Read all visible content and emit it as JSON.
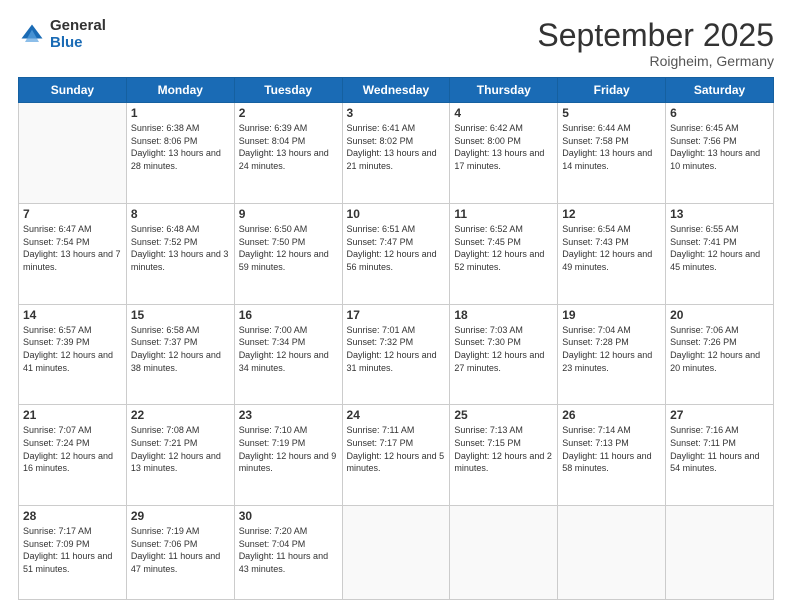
{
  "header": {
    "logo_general": "General",
    "logo_blue": "Blue",
    "title": "September 2025",
    "location": "Roigheim, Germany"
  },
  "days_of_week": [
    "Sunday",
    "Monday",
    "Tuesday",
    "Wednesday",
    "Thursday",
    "Friday",
    "Saturday"
  ],
  "weeks": [
    [
      {
        "day": "",
        "info": ""
      },
      {
        "day": "1",
        "info": "Sunrise: 6:38 AM\nSunset: 8:06 PM\nDaylight: 13 hours and 28 minutes."
      },
      {
        "day": "2",
        "info": "Sunrise: 6:39 AM\nSunset: 8:04 PM\nDaylight: 13 hours and 24 minutes."
      },
      {
        "day": "3",
        "info": "Sunrise: 6:41 AM\nSunset: 8:02 PM\nDaylight: 13 hours and 21 minutes."
      },
      {
        "day": "4",
        "info": "Sunrise: 6:42 AM\nSunset: 8:00 PM\nDaylight: 13 hours and 17 minutes."
      },
      {
        "day": "5",
        "info": "Sunrise: 6:44 AM\nSunset: 7:58 PM\nDaylight: 13 hours and 14 minutes."
      },
      {
        "day": "6",
        "info": "Sunrise: 6:45 AM\nSunset: 7:56 PM\nDaylight: 13 hours and 10 minutes."
      }
    ],
    [
      {
        "day": "7",
        "info": "Sunrise: 6:47 AM\nSunset: 7:54 PM\nDaylight: 13 hours and 7 minutes."
      },
      {
        "day": "8",
        "info": "Sunrise: 6:48 AM\nSunset: 7:52 PM\nDaylight: 13 hours and 3 minutes."
      },
      {
        "day": "9",
        "info": "Sunrise: 6:50 AM\nSunset: 7:50 PM\nDaylight: 12 hours and 59 minutes."
      },
      {
        "day": "10",
        "info": "Sunrise: 6:51 AM\nSunset: 7:47 PM\nDaylight: 12 hours and 56 minutes."
      },
      {
        "day": "11",
        "info": "Sunrise: 6:52 AM\nSunset: 7:45 PM\nDaylight: 12 hours and 52 minutes."
      },
      {
        "day": "12",
        "info": "Sunrise: 6:54 AM\nSunset: 7:43 PM\nDaylight: 12 hours and 49 minutes."
      },
      {
        "day": "13",
        "info": "Sunrise: 6:55 AM\nSunset: 7:41 PM\nDaylight: 12 hours and 45 minutes."
      }
    ],
    [
      {
        "day": "14",
        "info": "Sunrise: 6:57 AM\nSunset: 7:39 PM\nDaylight: 12 hours and 41 minutes."
      },
      {
        "day": "15",
        "info": "Sunrise: 6:58 AM\nSunset: 7:37 PM\nDaylight: 12 hours and 38 minutes."
      },
      {
        "day": "16",
        "info": "Sunrise: 7:00 AM\nSunset: 7:34 PM\nDaylight: 12 hours and 34 minutes."
      },
      {
        "day": "17",
        "info": "Sunrise: 7:01 AM\nSunset: 7:32 PM\nDaylight: 12 hours and 31 minutes."
      },
      {
        "day": "18",
        "info": "Sunrise: 7:03 AM\nSunset: 7:30 PM\nDaylight: 12 hours and 27 minutes."
      },
      {
        "day": "19",
        "info": "Sunrise: 7:04 AM\nSunset: 7:28 PM\nDaylight: 12 hours and 23 minutes."
      },
      {
        "day": "20",
        "info": "Sunrise: 7:06 AM\nSunset: 7:26 PM\nDaylight: 12 hours and 20 minutes."
      }
    ],
    [
      {
        "day": "21",
        "info": "Sunrise: 7:07 AM\nSunset: 7:24 PM\nDaylight: 12 hours and 16 minutes."
      },
      {
        "day": "22",
        "info": "Sunrise: 7:08 AM\nSunset: 7:21 PM\nDaylight: 12 hours and 13 minutes."
      },
      {
        "day": "23",
        "info": "Sunrise: 7:10 AM\nSunset: 7:19 PM\nDaylight: 12 hours and 9 minutes."
      },
      {
        "day": "24",
        "info": "Sunrise: 7:11 AM\nSunset: 7:17 PM\nDaylight: 12 hours and 5 minutes."
      },
      {
        "day": "25",
        "info": "Sunrise: 7:13 AM\nSunset: 7:15 PM\nDaylight: 12 hours and 2 minutes."
      },
      {
        "day": "26",
        "info": "Sunrise: 7:14 AM\nSunset: 7:13 PM\nDaylight: 11 hours and 58 minutes."
      },
      {
        "day": "27",
        "info": "Sunrise: 7:16 AM\nSunset: 7:11 PM\nDaylight: 11 hours and 54 minutes."
      }
    ],
    [
      {
        "day": "28",
        "info": "Sunrise: 7:17 AM\nSunset: 7:09 PM\nDaylight: 11 hours and 51 minutes."
      },
      {
        "day": "29",
        "info": "Sunrise: 7:19 AM\nSunset: 7:06 PM\nDaylight: 11 hours and 47 minutes."
      },
      {
        "day": "30",
        "info": "Sunrise: 7:20 AM\nSunset: 7:04 PM\nDaylight: 11 hours and 43 minutes."
      },
      {
        "day": "",
        "info": ""
      },
      {
        "day": "",
        "info": ""
      },
      {
        "day": "",
        "info": ""
      },
      {
        "day": "",
        "info": ""
      }
    ]
  ]
}
